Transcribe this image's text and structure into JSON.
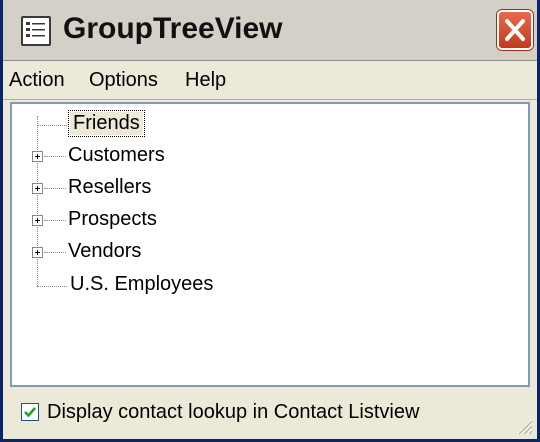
{
  "window": {
    "title": "GroupTreeView",
    "icon": "list-window-icon",
    "close_icon": "close-icon"
  },
  "menu": {
    "items": [
      {
        "label": "Action"
      },
      {
        "label": "Options"
      },
      {
        "label": "Help"
      }
    ]
  },
  "tree": {
    "nodes": [
      {
        "label": "Friends",
        "selected": true,
        "expandable": false
      },
      {
        "label": "Customers",
        "selected": false,
        "expandable": true
      },
      {
        "label": "Resellers",
        "selected": false,
        "expandable": true
      },
      {
        "label": "Prospects",
        "selected": false,
        "expandable": true
      },
      {
        "label": "Vendors",
        "selected": false,
        "expandable": true
      },
      {
        "label": "U.S. Employees",
        "selected": false,
        "expandable": false
      }
    ]
  },
  "status": {
    "checkbox_checked": true,
    "checkbox_label": "Display contact lookup in Contact Listview"
  },
  "colors": {
    "close_button": "#c23a1c",
    "tree_border": "#7f9db9",
    "check_mark": "#21a121"
  }
}
